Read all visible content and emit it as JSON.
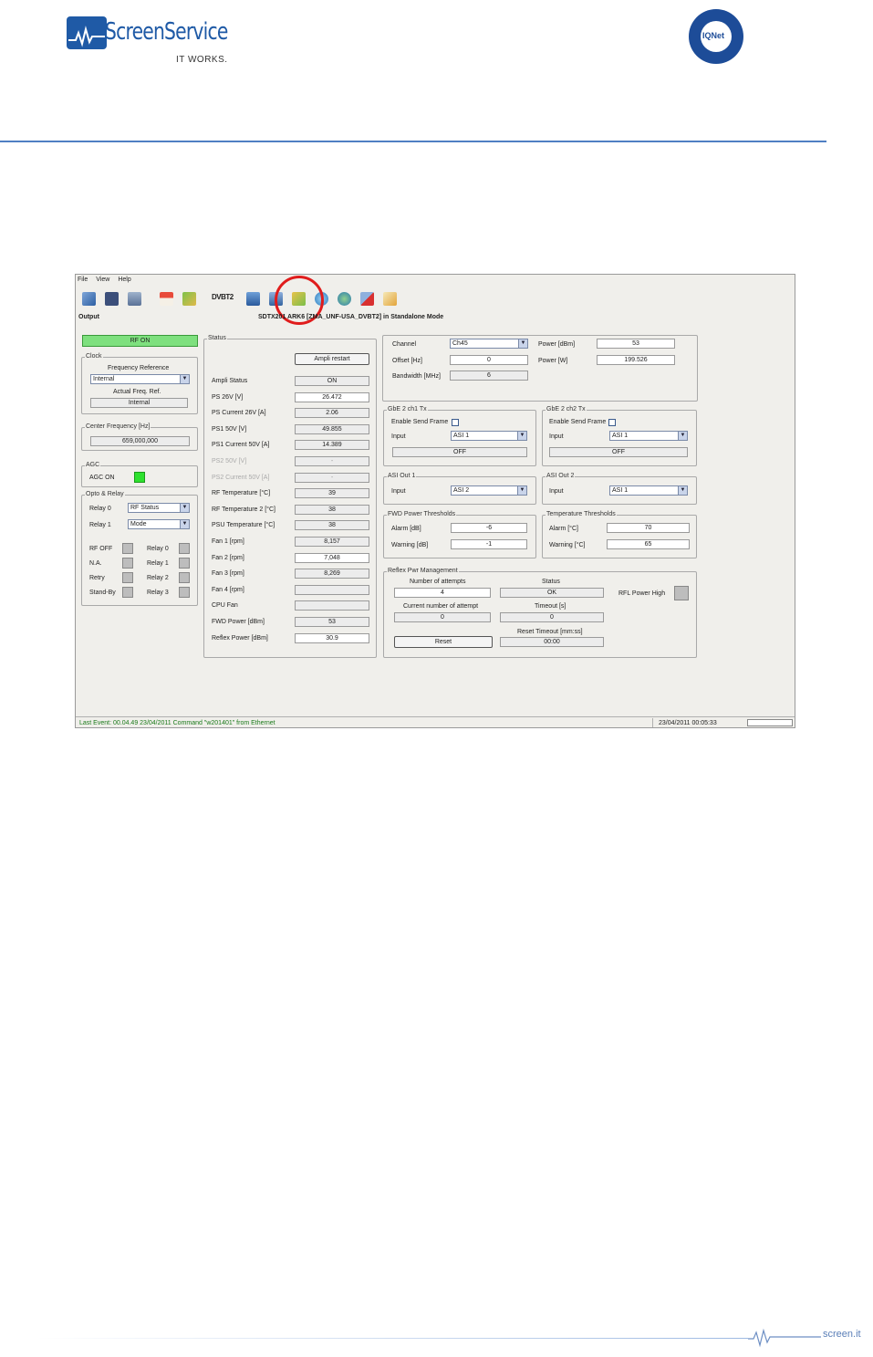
{
  "header": {
    "logo_name": "ScreenService",
    "logo_tagline": "IT WORKS.",
    "seal_text": "IQNet"
  },
  "app": {
    "menu": [
      "File",
      "View",
      "Help"
    ],
    "toolbar_icons": [
      "network-icon",
      "save-icon",
      "folder-icon",
      "home-icon",
      "refresh-icon",
      "dvbt2-icon",
      "monitor-icon",
      "display-icon",
      "amplifier-icon",
      "globe-icon",
      "earth-icon",
      "disconnect-icon",
      "edit-icon"
    ],
    "dvbt2_label": "DVBT2",
    "output_label": "Output",
    "title": "SDTX201 ARK6 [ZMA_UNF-USA_DVBT2] in Standalone Mode",
    "rf_on_label": "RF ON",
    "clock": {
      "legend": "Clock",
      "freq_ref_label": "Frequency Reference",
      "freq_ref_value": "Internal",
      "actual_label": "Actual Freq. Ref.",
      "actual_value": "Internal"
    },
    "center_freq": {
      "legend": "Center Frequency [Hz]",
      "value": "659,000,000"
    },
    "agc": {
      "legend": "AGC",
      "label": "AGC ON"
    },
    "opto": {
      "legend": "Opto & Relay",
      "relay0_label": "Relay 0",
      "relay0_value": "RF Status",
      "relay1_label": "Relay 1",
      "relay1_value": "Mode",
      "inputs": [
        "RF OFF",
        "N.A.",
        "Retry",
        "Stand-By"
      ],
      "relays": [
        "Relay 0",
        "Relay 1",
        "Relay 2",
        "Relay 3"
      ]
    },
    "status": {
      "legend": "Status",
      "restart_label": "Ampli restart",
      "rows": [
        {
          "label": "Ampli Status",
          "value": "ON"
        },
        {
          "label": "PS 26V [V]",
          "value": "26.472"
        },
        {
          "label": "PS Current 26V [A]",
          "value": "2.06"
        },
        {
          "label": "PS1 50V [V]",
          "value": "49.855"
        },
        {
          "label": "PS1 Current 50V [A]",
          "value": "14.389"
        },
        {
          "label": "PS2 50V [V]",
          "value": "-"
        },
        {
          "label": "PS2 Current 50V [A]",
          "value": "-"
        },
        {
          "label": "RF Temperature [°C]",
          "value": "39"
        },
        {
          "label": "RF Temperature 2 [°C]",
          "value": "38"
        },
        {
          "label": "PSU Temperature [°C]",
          "value": "38"
        },
        {
          "label": "Fan 1 [rpm]",
          "value": "8,157"
        },
        {
          "label": "Fan 2 [rpm]",
          "value": "7,048"
        },
        {
          "label": "Fan 3 [rpm]",
          "value": "8,269"
        },
        {
          "label": "Fan 4 [rpm]",
          "value": ""
        },
        {
          "label": "CPU Fan",
          "value": ""
        },
        {
          "label": "FWD Power [dBm]",
          "value": "53"
        },
        {
          "label": "Reflex Power [dBm]",
          "value": "30.9"
        }
      ]
    },
    "channel": {
      "channel_label": "Channel",
      "channel_value": "Ch45",
      "offset_label": "Offset [Hz]",
      "offset_value": "0",
      "bandwidth_label": "Bandwidth [MHz]",
      "bandwidth_value": "6",
      "power_dbm_label": "Power [dBm]",
      "power_dbm_value": "53",
      "power_w_label": "Power [W]",
      "power_w_value": "199.526"
    },
    "gbe1": {
      "legend": "GbE 2 ch1 Tx",
      "enable_label": "Enable Send Frame",
      "input_label": "Input",
      "input_value": "ASI 1",
      "state": "OFF"
    },
    "gbe2": {
      "legend": "GbE 2 ch2 Tx",
      "enable_label": "Enable Send Frame",
      "input_label": "Input",
      "input_value": "ASI 1",
      "state": "OFF"
    },
    "asi1": {
      "legend": "ASI Out 1",
      "input_label": "Input",
      "input_value": "ASI 2"
    },
    "asi2": {
      "legend": "ASI Out 2",
      "input_label": "Input",
      "input_value": "ASI 1"
    },
    "fwd": {
      "legend": "FWD Power Thresholds",
      "alarm_label": "Alarm [dB]",
      "alarm_value": "-6",
      "warning_label": "Warning [dB]",
      "warning_value": "-1"
    },
    "temp": {
      "legend": "Temperature Thresholds",
      "alarm_label": "Alarm [°C]",
      "alarm_value": "70",
      "warning_label": "Warning [°C]",
      "warning_value": "65"
    },
    "reflex": {
      "legend": "Reflex Pwr Management",
      "attempts_label": "Number of attempts",
      "attempts_value": "4",
      "status_label": "Status",
      "status_value": "OK",
      "current_label": "Current number of attempt",
      "current_value": "0",
      "timeout_label": "Timeout [s]",
      "timeout_value": "0",
      "reset_timeout_label": "Reset Timeout [mm:ss]",
      "reset_timeout_value": "00:00",
      "reset_label": "Reset",
      "rfl_label": "RFL Power High"
    },
    "statusbar": {
      "event": "Last Event: 00.04.49 23/04/2011 Command \"w201401\" from Ethernet",
      "datetime": "23/04/2011 00:05:33"
    }
  },
  "footer": {
    "site": "screen.it"
  },
  "colors": {
    "brand_blue": "#1f5aa6",
    "rule_blue": "#4f7fc3",
    "highlight_red": "#e01c1c",
    "ok_green": "#2ee12e"
  }
}
